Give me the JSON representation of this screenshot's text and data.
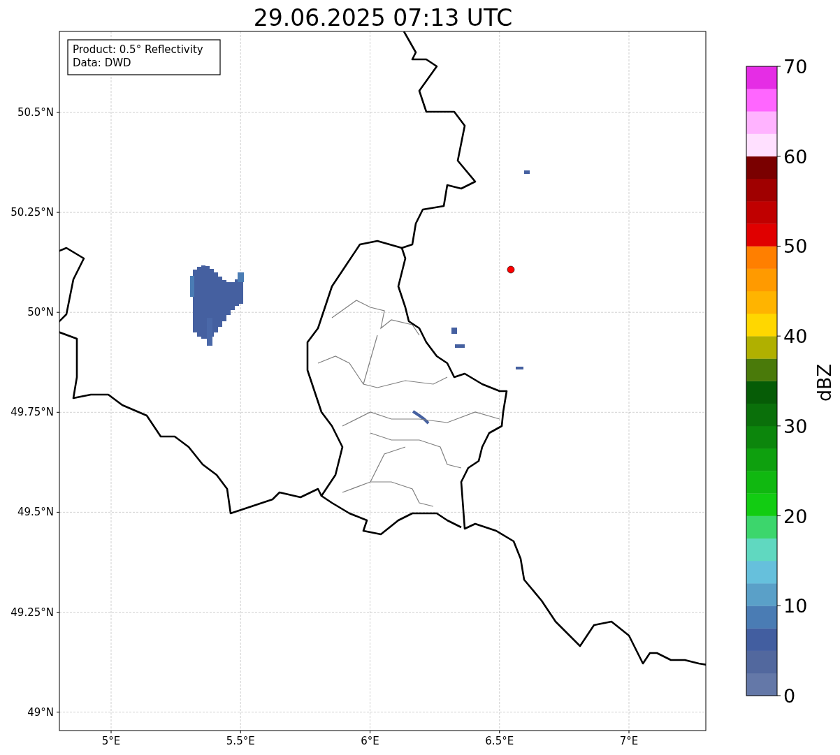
{
  "title": "29.06.2025 07:13 UTC",
  "info_box": {
    "lines": [
      "Product: 0.5° Reflectivity",
      "Data: DWD"
    ]
  },
  "map": {
    "lat_labels": [
      "50.5°N",
      "50.25°N",
      "50°N",
      "49.75°N",
      "49.5°N",
      "49.25°N",
      "49°N"
    ],
    "lon_labels": [
      "5°E",
      "5.5°E",
      "6°E",
      "6.5°E",
      "7°E"
    ]
  },
  "colorbar": {
    "label": "dBZ",
    "ticks": [
      "70",
      "60",
      "50",
      "40",
      "30",
      "20",
      "10",
      "0"
    ],
    "bands": [
      {
        "color": "#6478a8"
      },
      {
        "color": "#52689e"
      },
      {
        "color": "#425ea0"
      },
      {
        "color": "#4a7cb4"
      },
      {
        "color": "#5aa0c8"
      },
      {
        "color": "#66c0dc"
      },
      {
        "color": "#60d8c0"
      },
      {
        "color": "#3cd66c"
      },
      {
        "color": "#12cc12"
      },
      {
        "color": "#10b810"
      },
      {
        "color": "#0ea00e"
      },
      {
        "color": "#0c860c"
      },
      {
        "color": "#0a700a"
      },
      {
        "color": "#065c06"
      },
      {
        "color": "#4a7a0a"
      },
      {
        "color": "#b0b000"
      },
      {
        "color": "#ffd700"
      },
      {
        "color": "#ffb400"
      },
      {
        "color": "#ff9a00"
      },
      {
        "color": "#ff7f00"
      },
      {
        "color": "#e00000"
      },
      {
        "color": "#c00000"
      },
      {
        "color": "#a00000"
      },
      {
        "color": "#7a0000"
      },
      {
        "color": "#ffe0ff"
      },
      {
        "color": "#ffb3ff"
      },
      {
        "color": "#ff66ff"
      },
      {
        "color": "#e52de5"
      }
    ]
  }
}
